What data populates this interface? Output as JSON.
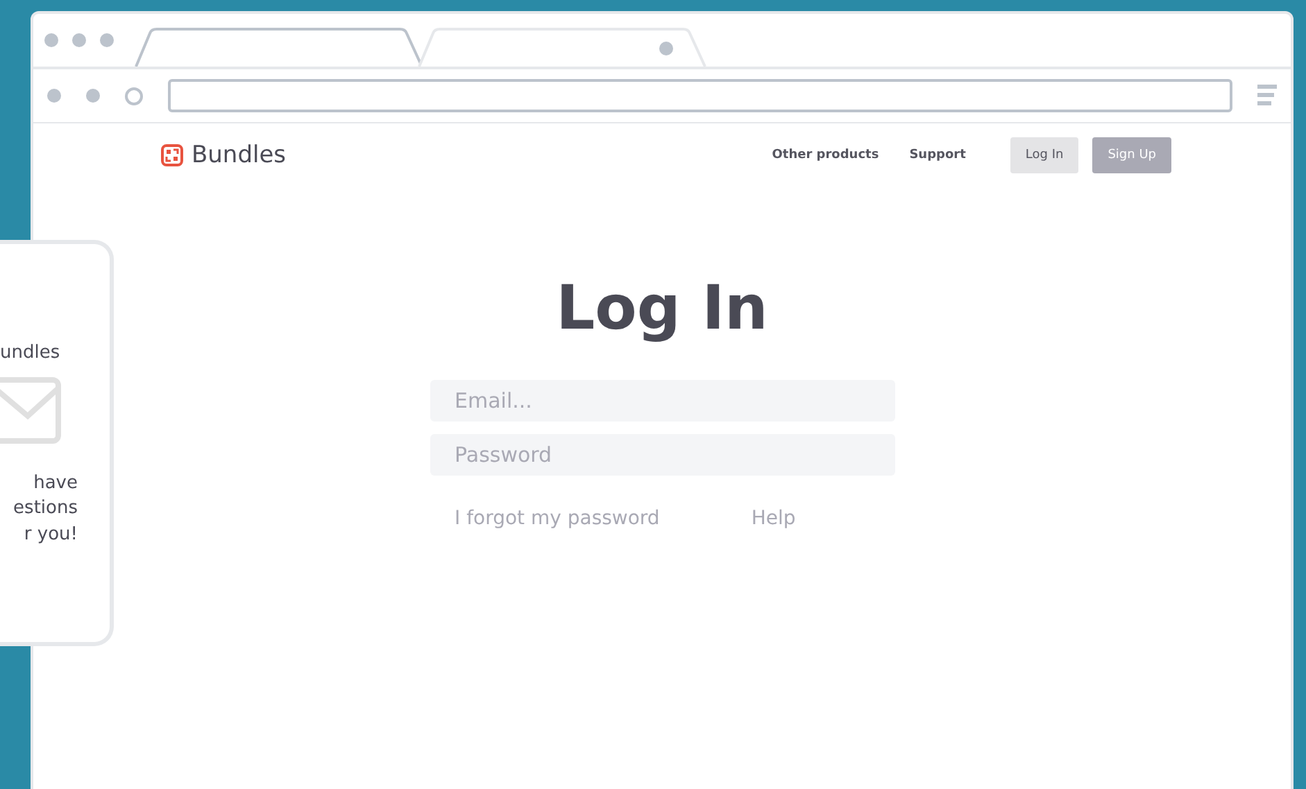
{
  "browser": {
    "tabs": [
      {
        "selected": true
      },
      {
        "selected": false
      }
    ]
  },
  "header": {
    "brand": "Bundles",
    "links": [
      "Other products",
      "Support"
    ],
    "buttons": [
      {
        "label": "Log In",
        "kind": "secondary"
      },
      {
        "label": "Sign Up",
        "kind": "primary"
      }
    ]
  },
  "login": {
    "title": "Log In",
    "fields": [
      {
        "placeholder": "Email..."
      },
      {
        "placeholder": "Password"
      }
    ],
    "links": [
      "I forgot my password",
      "Help"
    ]
  },
  "phone": {
    "brand": "undles",
    "message": [
      "have",
      "estions",
      "r you!"
    ]
  }
}
